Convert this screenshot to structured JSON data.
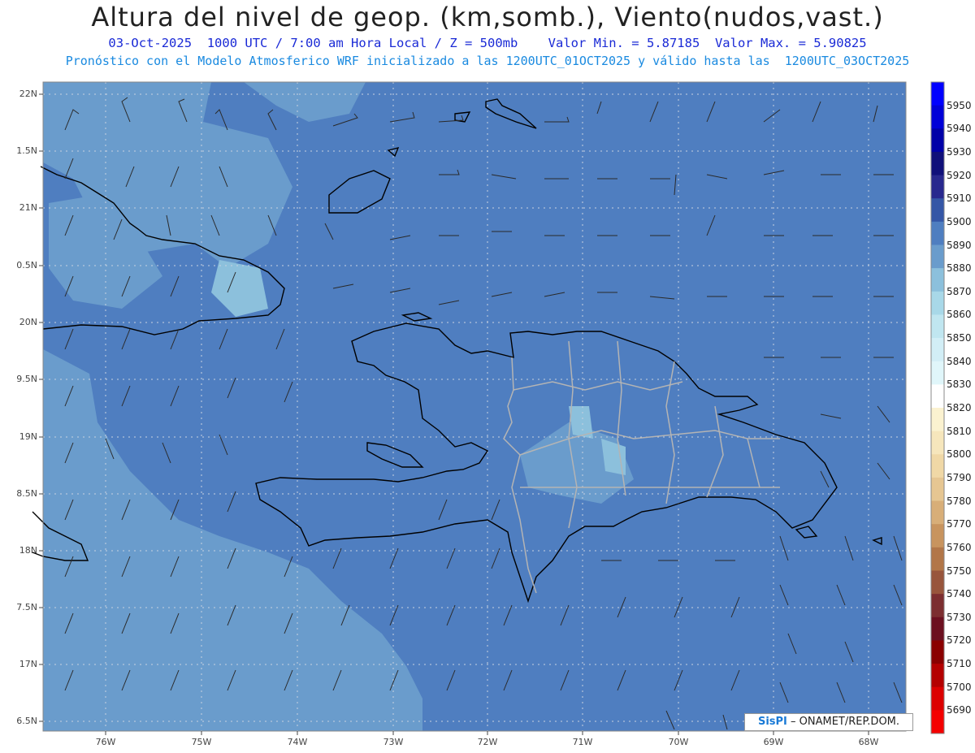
{
  "title": "Altura del nivel de geop. (km,somb.), Viento(nudos,vast.)",
  "subtitle1": "03-Oct-2025  1000 UTC / 7:00 am Hora Local / Z = 500mb    Valor Min. = 5.87185  Valor Max. = 5.90825",
  "subtitle2": "Pronóstico con el Modelo Atmosferico WRF inicializado a las 1200UTC_01OCT2025 y válido hasta las  1200UTC_03OCT2025",
  "lat_labels": [
    "22N",
    "1.5N",
    "21N",
    "0.5N",
    "20N",
    "9.5N",
    "19N",
    "8.5N",
    "18N",
    "7.5N",
    "17N",
    "6.5N"
  ],
  "lon_labels": [
    "76W",
    "75W",
    "74W",
    "73W",
    "72W",
    "71W",
    "70W",
    "69W",
    "68W"
  ],
  "colorbar": {
    "labels": [
      "5950",
      "5940",
      "5930",
      "5920",
      "5910",
      "5900",
      "5890",
      "5880",
      "5870",
      "5860",
      "5850",
      "5840",
      "5830",
      "5820",
      "5810",
      "5800",
      "5790",
      "5780",
      "5770",
      "5760",
      "5750",
      "5740",
      "5730",
      "5720",
      "5710",
      "5700",
      "5690"
    ],
    "colors": [
      "#0000ff",
      "#0000d8",
      "#0000a8",
      "#10107a",
      "#28288e",
      "#3556a6",
      "#4f7ec0",
      "#6a9ccc",
      "#8cc0dc",
      "#a8d8e8",
      "#c0e6f0",
      "#d2eef6",
      "#e0f6fa",
      "#ffffff",
      "#fbf2d0",
      "#f6e6bc",
      "#f0d8a6",
      "#e6c692",
      "#d8ae78",
      "#c8945e",
      "#b27648",
      "#98553c",
      "#7c2e30",
      "#6c1020",
      "#8a0000",
      "#b40000",
      "#dc0000",
      "#f40000"
    ]
  },
  "colors": {
    "field_dark": "#4f7ec0",
    "field_light": "#6a9ccc",
    "field_lighter": "#8cc0dc",
    "coast": "#000000",
    "borders": "#b4b4b4"
  },
  "credit": {
    "logo": "SisPI",
    "text": " – ONAMET/REP.DOM."
  }
}
